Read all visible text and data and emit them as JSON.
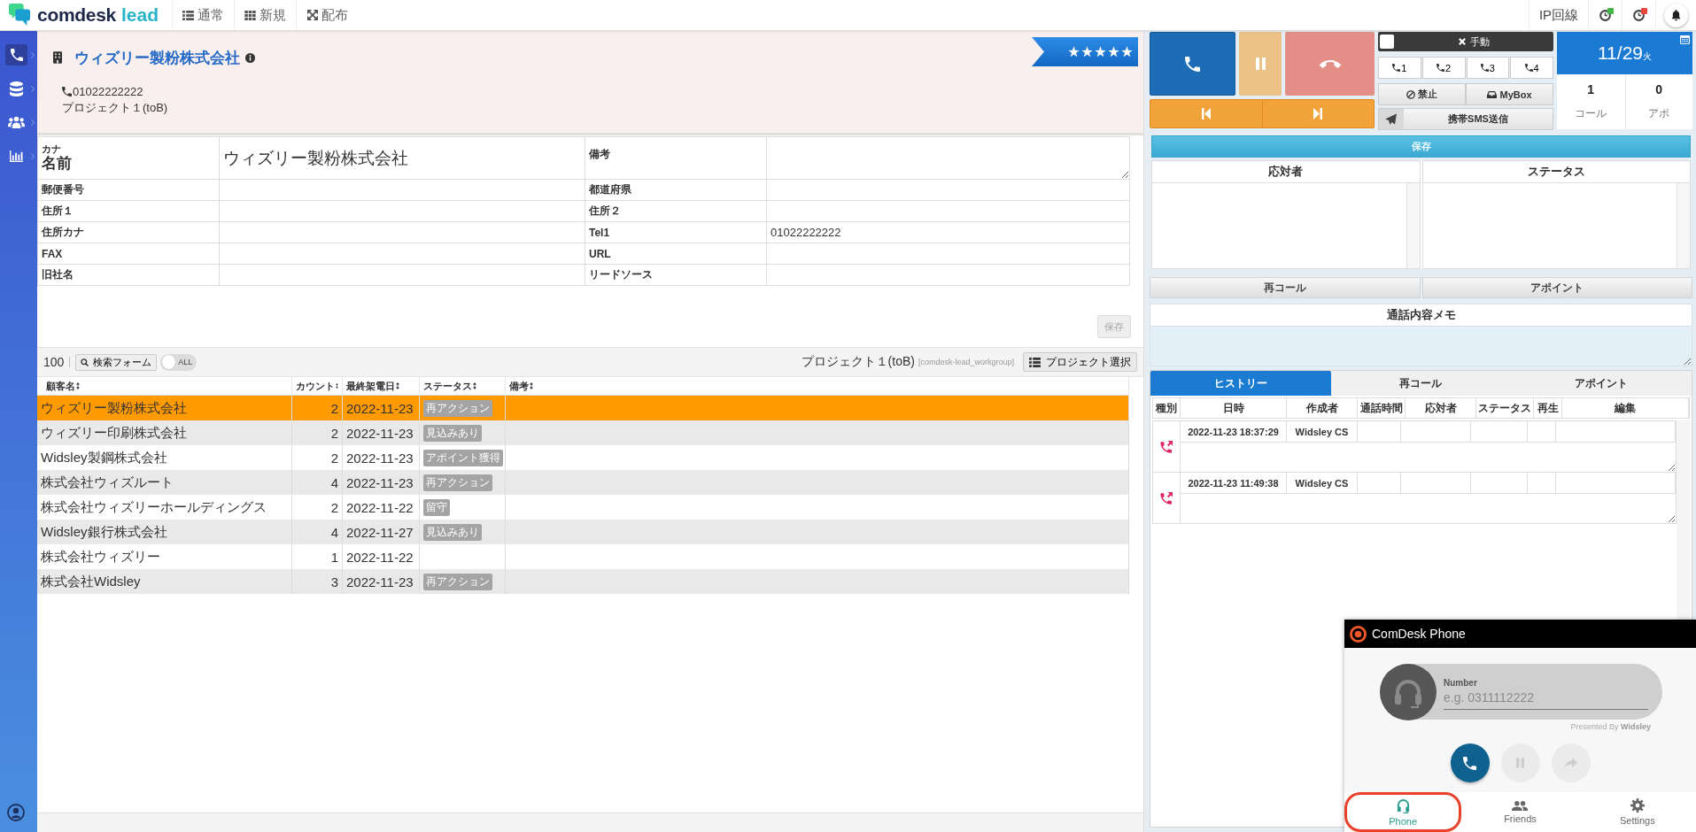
{
  "header": {
    "brand": "comdesk",
    "product": "lead",
    "nav": [
      "通常",
      "新規",
      "配布"
    ],
    "line_label": "IP回線",
    "indicators": [
      {
        "color": "#43b649"
      },
      {
        "color": "#e8453c"
      }
    ]
  },
  "sidebar": {
    "items": [
      {
        "selected": true
      },
      {
        "selected": false
      },
      {
        "selected": false
      },
      {
        "selected": false
      }
    ]
  },
  "company": {
    "name": "ウィズリー製粉株式会社",
    "phone": "01022222222",
    "project": "プロジェクト１(toB)",
    "stars": 5
  },
  "form": {
    "name_caption": "カナ",
    "name_label": "名前",
    "name_value": "ウィズリー製粉株式会社",
    "remarks_label": "備考",
    "fields": [
      {
        "label": "郵便番号"
      },
      {
        "label": "都道府県"
      },
      {
        "label": "住所１"
      },
      {
        "label": "住所２"
      },
      {
        "label": "住所カナ"
      },
      {
        "label": "Tel1",
        "value": "01022222222"
      },
      {
        "label": "FAX"
      },
      {
        "label": "URL"
      },
      {
        "label": "旧社名"
      },
      {
        "label": "リードソース"
      }
    ],
    "save_button": {
      "label": "保存",
      "disabled": true
    }
  },
  "list": {
    "count": "100",
    "search_button": "検索フォーム",
    "toggle": {
      "label": "ALL",
      "on": false
    },
    "project": "プロジェクト１(toB)",
    "workgroup": "[comdesk-lead_workgroup]",
    "project_button": "プロジェクト選択",
    "columns": [
      "顧客名",
      "カウント",
      "最終架電日",
      "ステータス",
      "備考"
    ],
    "rows": [
      {
        "name": "ウィズリー製粉株式会社",
        "count": "2",
        "date": "2022-11-23",
        "status": "再アクション",
        "selected": true
      },
      {
        "name": "ウィズリー印刷株式会社",
        "count": "2",
        "date": "2022-11-23",
        "status": "見込みあり",
        "selected": false
      },
      {
        "name": "Widsley製鋼株式会社",
        "count": "2",
        "date": "2022-11-23",
        "status": "アポイント獲得",
        "selected": false
      },
      {
        "name": "株式会社ウィズルート",
        "count": "4",
        "date": "2022-11-23",
        "status": "再アクション",
        "selected": false
      },
      {
        "name": "株式会社ウィズリーホールディングス",
        "count": "2",
        "date": "2022-11-22",
        "status": "留守",
        "selected": false
      },
      {
        "name": "Widsley銀行株式会社",
        "count": "4",
        "date": "2022-11-27",
        "status": "見込みあり",
        "selected": false
      },
      {
        "name": "株式会社ウィズリー",
        "count": "1",
        "date": "2022-11-22",
        "selected": false
      },
      {
        "name": "株式会社Widsley",
        "count": "3",
        "date": "2022-11-23",
        "status": "再アクション",
        "selected": false
      }
    ]
  },
  "dialer": {
    "manual": {
      "label": "手動",
      "checked": false
    },
    "lines": [
      "1",
      "2",
      "3",
      "4"
    ],
    "block_button": "禁止",
    "mybox_button": "MyBox",
    "sms_button": "携帯SMS送信"
  },
  "summary": {
    "date": "11/29",
    "weekday": "火",
    "stats": [
      {
        "value": "1",
        "label": "コール"
      },
      {
        "value": "0",
        "label": "アポ"
      }
    ]
  },
  "save_button": "保存",
  "selectors": [
    {
      "title": "応対者"
    },
    {
      "title": "ステータス"
    }
  ],
  "actions": [
    "再コール",
    "アポイント"
  ],
  "memo": {
    "title": "通話内容メモ"
  },
  "history": {
    "tabs": [
      {
        "label": "ヒストリー",
        "selected": true
      },
      {
        "label": "再コール",
        "selected": false
      },
      {
        "label": "アポイント",
        "selected": false
      }
    ],
    "columns": [
      "種別",
      "日時",
      "作成者",
      "通話時間",
      "応対者",
      "ステータス",
      "再生",
      "編集"
    ],
    "rows": [
      {
        "datetime": "2022-11-23 18:37:29",
        "author": "Widsley CS"
      },
      {
        "datetime": "2022-11-23 11:49:38",
        "author": "Widsley CS"
      }
    ]
  },
  "phone_widget": {
    "title": "ComDesk Phone",
    "number_label": "Number",
    "placeholder": "e.g. 0311112222",
    "credit": "Presented By **Widsley**",
    "buttons": [
      {
        "disabled": false
      },
      {
        "disabled": true
      },
      {
        "disabled": true
      }
    ],
    "nav": [
      {
        "label": "Phone",
        "selected": true,
        "highlighted": true
      },
      {
        "label": "Friends",
        "selected": false,
        "highlighted": false
      },
      {
        "label": "Settings",
        "selected": false,
        "highlighted": false
      }
    ]
  }
}
